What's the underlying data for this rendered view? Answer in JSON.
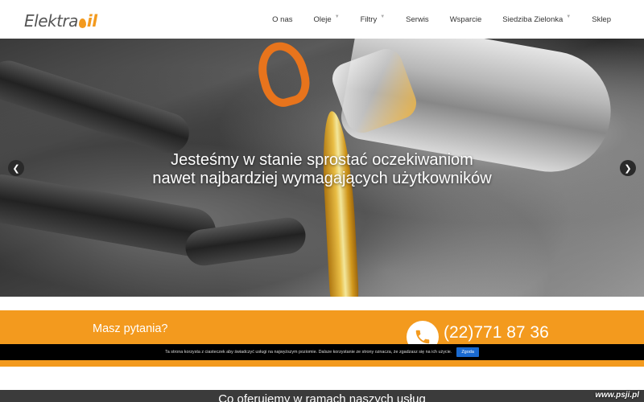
{
  "header": {
    "logo_text_main": "Elektra",
    "logo_text_accent": "il",
    "nav": [
      {
        "label": "O nas",
        "has_dropdown": false
      },
      {
        "label": "Oleje",
        "has_dropdown": true
      },
      {
        "label": "Filtry",
        "has_dropdown": true
      },
      {
        "label": "Serwis",
        "has_dropdown": false
      },
      {
        "label": "Wsparcie",
        "has_dropdown": false
      },
      {
        "label": "Siedziba Zielonka",
        "has_dropdown": true
      },
      {
        "label": "Sklep",
        "has_dropdown": false
      }
    ]
  },
  "hero": {
    "title_line1": "Jesteśmy w stanie sprostać oczekiwaniom",
    "title_line2": "nawet najbardziej wymagających użytkowników",
    "prev_icon": "chevron-left-icon",
    "next_icon": "chevron-right-icon"
  },
  "contact_band": {
    "question": "Masz pytania?",
    "phone": "(22)771 87 36",
    "phone_icon": "phone-icon"
  },
  "cookie_bar": {
    "text": "Ta strona korzysta z ciasteczek aby świadczyć usługi na najwyższym poziomie. Dalsze korzystanie ze strony oznacza, że zgadzasz się na ich użycie.",
    "button": "Zgoda"
  },
  "services": {
    "title": "Co oferujemy w ramach naszych usług"
  },
  "watermark": "www.psji.pl",
  "colors": {
    "accent": "#f39a1e",
    "cookie_button": "#1a6ad1",
    "dark_section": "#3b3b3b"
  }
}
